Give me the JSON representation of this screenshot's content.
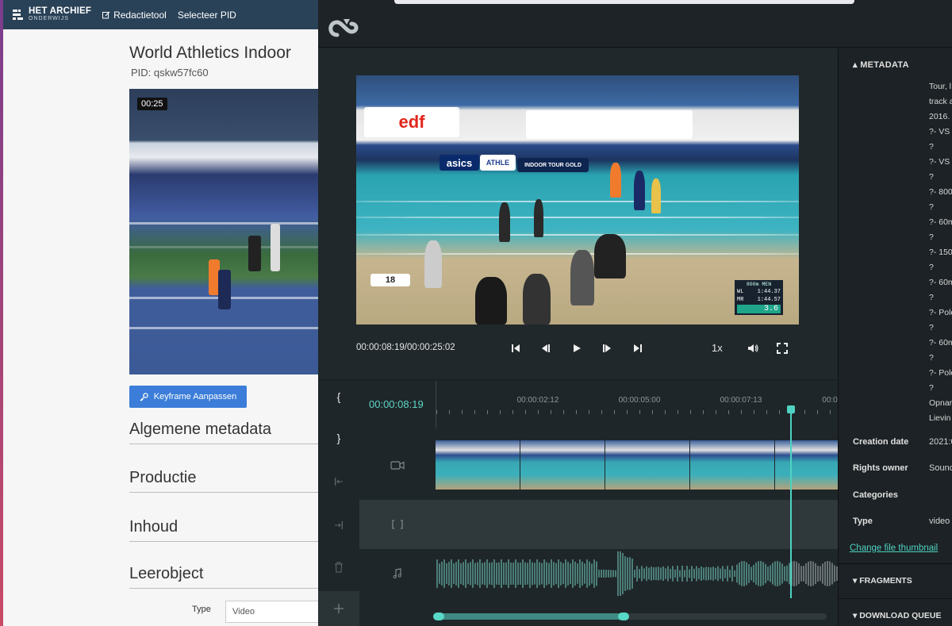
{
  "left_app": {
    "logo_line1": "HET ARCHIEF",
    "logo_line2": "ONDERWIJS",
    "nav": {
      "redactietool": "Redactietool",
      "selecteer_pid": "Selecteer PID"
    },
    "title": "World Athletics Indoor",
    "pid": "PID: qskw57fc60",
    "thumbnail_time": "00:25",
    "keyframe_button": "Keyframe Aanpassen",
    "sections": [
      "Algemene metadata",
      "Productie",
      "Inhoud",
      "Leerobject"
    ],
    "type_label": "Type",
    "type_value": "Video"
  },
  "editor": {
    "video_scoreboard": {
      "event": "800m MEN",
      "wl_label": "WL",
      "wl": "1:44.37",
      "mr_label": "MR",
      "mr": "1:44.57",
      "split": "3.6"
    },
    "ad_edf": "edf",
    "ad_asics": "asics",
    "ad_athle": "ATHLE",
    "ad_itg": "INDOOR TOUR GOLD",
    "lane_number": "18",
    "time_display": "00:00:08:19/00:00:25:02",
    "speed": "1x",
    "timeline": {
      "current_time": "00:00:08:19",
      "ruler_marks": [
        "00:00:02:12",
        "00:00:05:00",
        "00:00:07:13",
        "00:0"
      ],
      "tools": [
        "{",
        "}"
      ]
    },
    "metadata": {
      "header": "METADATA",
      "description_lines": [
        "Tour, l",
        "track a",
        "2016.",
        "?- VS 8",
        "?",
        "?- VS 6",
        "?",
        "?- 800",
        "?",
        "?- 60m",
        "?",
        "?- 150",
        "?",
        "?- 60m",
        "?",
        "?- Pole",
        "?",
        "?- 60m",
        "?",
        "?- Pole",
        "?",
        "Opnar",
        "Lievin"
      ],
      "fields": [
        {
          "key": "Creation date",
          "value": "2021:0"
        },
        {
          "key": "Rights owner",
          "value": "Sounc"
        },
        {
          "key": "Categories",
          "value": ""
        },
        {
          "key": "Type",
          "value": "video"
        }
      ],
      "thumbnail_link": "Change file thumbnail",
      "fragments": "FRAGMENTS",
      "download_queue": "DOWNLOAD QUEUE"
    }
  },
  "colors": {
    "accent": "#4fd2c2",
    "nav": "#2a4258",
    "button": "#3b7dd8"
  }
}
